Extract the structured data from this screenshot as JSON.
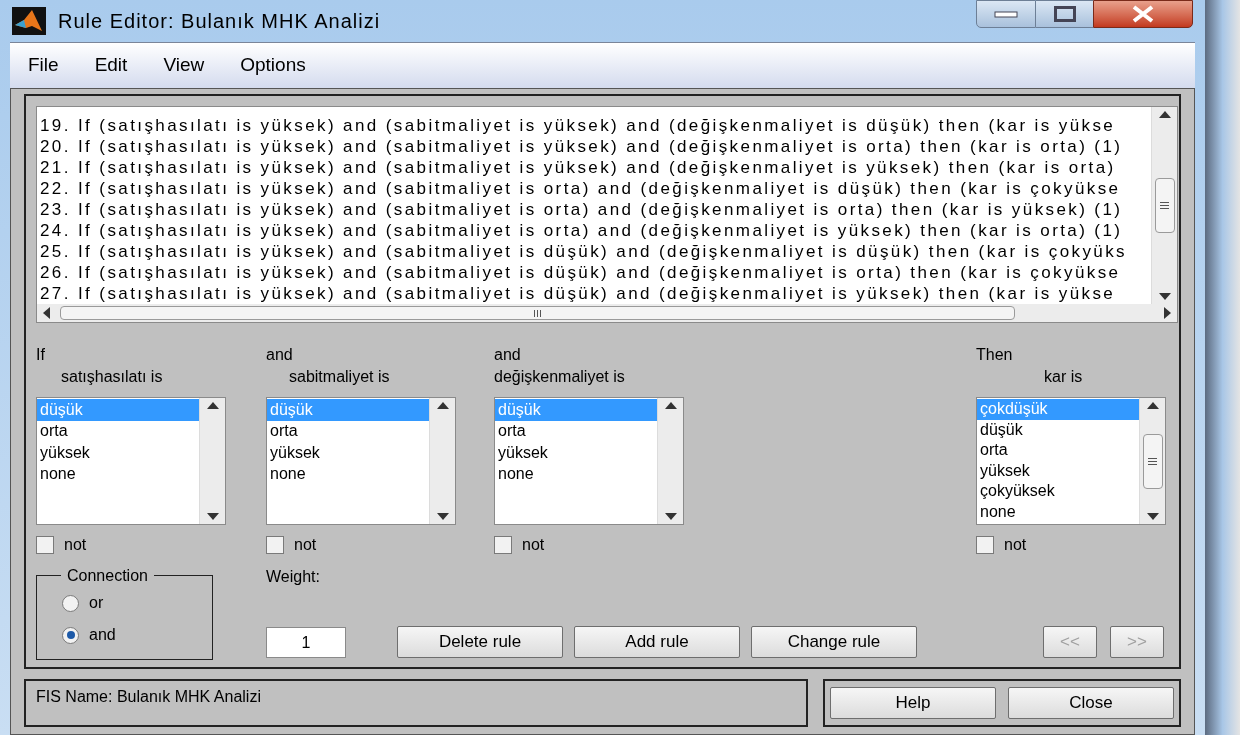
{
  "window": {
    "title": "Rule Editor: Bulanık MHK Analizi"
  },
  "menu": [
    "File",
    "Edit",
    "View",
    "Options"
  ],
  "rules": [
    "19. If (satışhasılatı is yüksek) and (sabitmaliyet is yüksek) and (değişkenmaliyet is düşük) then (kar is yükse",
    "20. If (satışhasılatı is yüksek) and (sabitmaliyet is yüksek) and (değişkenmaliyet is orta) then (kar is orta) (1)",
    "21. If (satışhasılatı is yüksek) and (sabitmaliyet is yüksek) and (değişkenmaliyet is yüksek) then (kar is orta)",
    "22. If (satışhasılatı is yüksek) and (sabitmaliyet is orta) and (değişkenmaliyet is düşük) then (kar is çokyükse",
    "23. If (satışhasılatı is yüksek) and (sabitmaliyet is orta) and (değişkenmaliyet is orta) then (kar is yüksek) (1)",
    "24. If (satışhasılatı is yüksek) and (sabitmaliyet is orta) and (değişkenmaliyet is yüksek) then (kar is orta) (1)",
    "25. If (satışhasılatı is yüksek) and (sabitmaliyet is düşük) and (değişkenmaliyet is düşük) then (kar is çokyüks",
    "26. If (satışhasılatı is yüksek) and (sabitmaliyet is düşük) and (değişkenmaliyet is orta) then (kar is çokyükse",
    "27. If (satışhasılatı is yüksek) and (sabitmaliyet is düşük) and (değişkenmaliyet is yüksek) then (kar is yükse"
  ],
  "inputs": [
    {
      "header": "If",
      "label": "satışhasılatı is",
      "items": [
        {
          "text": "düşük",
          "selected": true
        },
        {
          "text": "orta",
          "selected": false
        },
        {
          "text": "yüksek",
          "selected": false
        },
        {
          "text": "none",
          "selected": false
        }
      ],
      "not_label": "not",
      "not": false
    },
    {
      "header": "and",
      "label": "sabitmaliyet is",
      "items": [
        {
          "text": "düşük",
          "selected": true
        },
        {
          "text": "orta",
          "selected": false
        },
        {
          "text": "yüksek",
          "selected": false
        },
        {
          "text": "none",
          "selected": false
        }
      ],
      "not_label": "not",
      "not": false
    },
    {
      "header": "and",
      "label": "değişkenmaliyet is",
      "items": [
        {
          "text": "düşük",
          "selected": true
        },
        {
          "text": "orta",
          "selected": false
        },
        {
          "text": "yüksek",
          "selected": false
        },
        {
          "text": "none",
          "selected": false
        }
      ],
      "not_label": "not",
      "not": false
    }
  ],
  "output": {
    "header": "Then",
    "label": "kar is",
    "items": [
      {
        "text": "çokdüşük",
        "selected": true
      },
      {
        "text": "düşük",
        "selected": false
      },
      {
        "text": "orta",
        "selected": false
      },
      {
        "text": "yüksek",
        "selected": false
      },
      {
        "text": "çokyüksek",
        "selected": false
      },
      {
        "text": "none",
        "selected": false
      }
    ],
    "not_label": "not",
    "not": false
  },
  "connection": {
    "title": "Connection",
    "options": [
      {
        "label": "or",
        "selected": false
      },
      {
        "label": "and",
        "selected": true
      }
    ]
  },
  "weight": {
    "label": "Weight:",
    "value": "1"
  },
  "buttons": [
    "Delete rule",
    "Add rule",
    "Change rule"
  ],
  "nav_buttons": [
    {
      "label": "<<",
      "disabled": true
    },
    {
      "label": ">>",
      "disabled": true
    }
  ],
  "status": "FIS Name: Bulanık MHK Analizi",
  "footer_buttons": [
    "Help",
    "Close"
  ]
}
